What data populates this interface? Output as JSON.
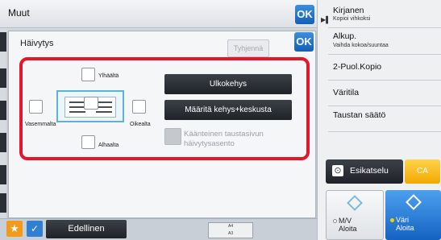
{
  "header": {
    "title": "Muut",
    "ok_label": "OK"
  },
  "dialog": {
    "title": "Häivytys",
    "clear_label": "Tyhjennä",
    "ok_label": "OK",
    "checkboxes": {
      "top": "Ylhäältä",
      "left": "Vasemmalta",
      "right": "Oikealta",
      "bottom": "Alhaalta"
    },
    "outer_frame_label": "Ulkokehys",
    "frame_center_label": "Määritä kehys+keskusta",
    "inverse_label": "Käänteinen taustasivun häivytysasento"
  },
  "bottom": {
    "previous_label": "Edellinen",
    "thumb_top": "A4",
    "thumb_bottom": "A3"
  },
  "sidebar": {
    "items": [
      {
        "label": "Kirjanen",
        "sub": "Kopioi vihkoksi"
      },
      {
        "label": "Alkup.",
        "sub": "Vaihda kokoa/suuntaa"
      },
      {
        "label": "2-Puol.Kopio"
      },
      {
        "label": "Väritila"
      },
      {
        "label": "Taustan säätö"
      }
    ]
  },
  "actions": {
    "preview_label": "Esikatselu",
    "ca_label": "CA",
    "mono_line1": "M/V",
    "mono_line2": "Aloita",
    "color_line1": "Väri",
    "color_line2": "Aloita"
  },
  "colors": {
    "accent": "#2f7fd3",
    "highlight": "#e3172a",
    "ca": "#f3a800"
  }
}
